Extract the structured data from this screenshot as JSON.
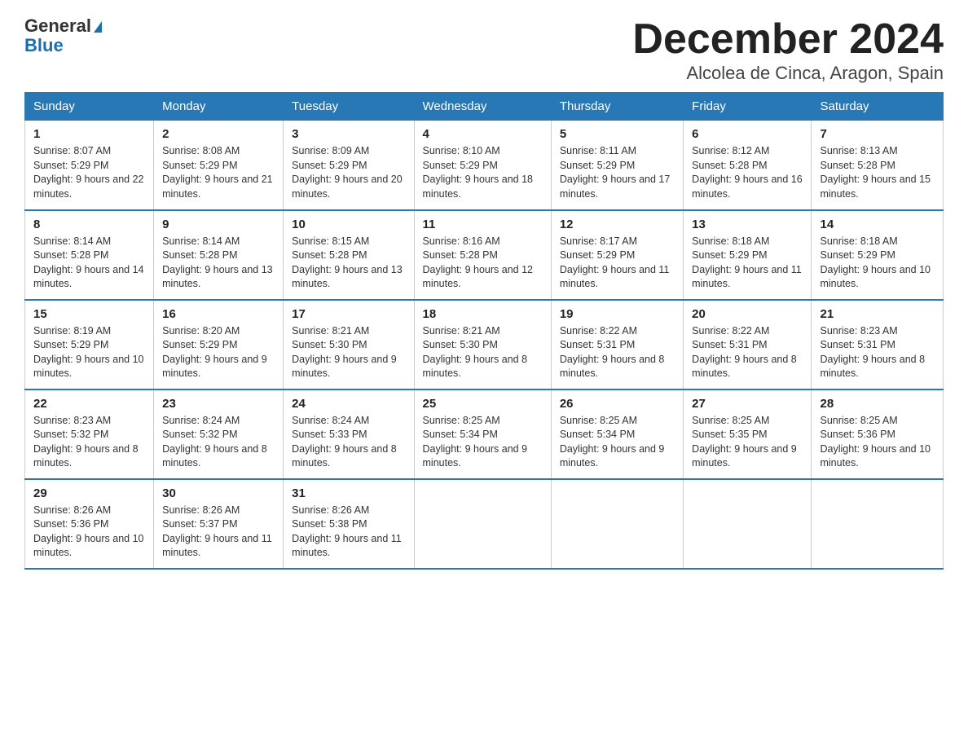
{
  "logo": {
    "line1": "General",
    "line2": "Blue"
  },
  "title": "December 2024",
  "subtitle": "Alcolea de Cinca, Aragon, Spain",
  "days_of_week": [
    "Sunday",
    "Monday",
    "Tuesday",
    "Wednesday",
    "Thursday",
    "Friday",
    "Saturday"
  ],
  "weeks": [
    [
      {
        "day": "1",
        "sunrise": "8:07 AM",
        "sunset": "5:29 PM",
        "daylight": "9 hours and 22 minutes."
      },
      {
        "day": "2",
        "sunrise": "8:08 AM",
        "sunset": "5:29 PM",
        "daylight": "9 hours and 21 minutes."
      },
      {
        "day": "3",
        "sunrise": "8:09 AM",
        "sunset": "5:29 PM",
        "daylight": "9 hours and 20 minutes."
      },
      {
        "day": "4",
        "sunrise": "8:10 AM",
        "sunset": "5:29 PM",
        "daylight": "9 hours and 18 minutes."
      },
      {
        "day": "5",
        "sunrise": "8:11 AM",
        "sunset": "5:29 PM",
        "daylight": "9 hours and 17 minutes."
      },
      {
        "day": "6",
        "sunrise": "8:12 AM",
        "sunset": "5:28 PM",
        "daylight": "9 hours and 16 minutes."
      },
      {
        "day": "7",
        "sunrise": "8:13 AM",
        "sunset": "5:28 PM",
        "daylight": "9 hours and 15 minutes."
      }
    ],
    [
      {
        "day": "8",
        "sunrise": "8:14 AM",
        "sunset": "5:28 PM",
        "daylight": "9 hours and 14 minutes."
      },
      {
        "day": "9",
        "sunrise": "8:14 AM",
        "sunset": "5:28 PM",
        "daylight": "9 hours and 13 minutes."
      },
      {
        "day": "10",
        "sunrise": "8:15 AM",
        "sunset": "5:28 PM",
        "daylight": "9 hours and 13 minutes."
      },
      {
        "day": "11",
        "sunrise": "8:16 AM",
        "sunset": "5:28 PM",
        "daylight": "9 hours and 12 minutes."
      },
      {
        "day": "12",
        "sunrise": "8:17 AM",
        "sunset": "5:29 PM",
        "daylight": "9 hours and 11 minutes."
      },
      {
        "day": "13",
        "sunrise": "8:18 AM",
        "sunset": "5:29 PM",
        "daylight": "9 hours and 11 minutes."
      },
      {
        "day": "14",
        "sunrise": "8:18 AM",
        "sunset": "5:29 PM",
        "daylight": "9 hours and 10 minutes."
      }
    ],
    [
      {
        "day": "15",
        "sunrise": "8:19 AM",
        "sunset": "5:29 PM",
        "daylight": "9 hours and 10 minutes."
      },
      {
        "day": "16",
        "sunrise": "8:20 AM",
        "sunset": "5:29 PM",
        "daylight": "9 hours and 9 minutes."
      },
      {
        "day": "17",
        "sunrise": "8:21 AM",
        "sunset": "5:30 PM",
        "daylight": "9 hours and 9 minutes."
      },
      {
        "day": "18",
        "sunrise": "8:21 AM",
        "sunset": "5:30 PM",
        "daylight": "9 hours and 8 minutes."
      },
      {
        "day": "19",
        "sunrise": "8:22 AM",
        "sunset": "5:31 PM",
        "daylight": "9 hours and 8 minutes."
      },
      {
        "day": "20",
        "sunrise": "8:22 AM",
        "sunset": "5:31 PM",
        "daylight": "9 hours and 8 minutes."
      },
      {
        "day": "21",
        "sunrise": "8:23 AM",
        "sunset": "5:31 PM",
        "daylight": "9 hours and 8 minutes."
      }
    ],
    [
      {
        "day": "22",
        "sunrise": "8:23 AM",
        "sunset": "5:32 PM",
        "daylight": "9 hours and 8 minutes."
      },
      {
        "day": "23",
        "sunrise": "8:24 AM",
        "sunset": "5:32 PM",
        "daylight": "9 hours and 8 minutes."
      },
      {
        "day": "24",
        "sunrise": "8:24 AM",
        "sunset": "5:33 PM",
        "daylight": "9 hours and 8 minutes."
      },
      {
        "day": "25",
        "sunrise": "8:25 AM",
        "sunset": "5:34 PM",
        "daylight": "9 hours and 9 minutes."
      },
      {
        "day": "26",
        "sunrise": "8:25 AM",
        "sunset": "5:34 PM",
        "daylight": "9 hours and 9 minutes."
      },
      {
        "day": "27",
        "sunrise": "8:25 AM",
        "sunset": "5:35 PM",
        "daylight": "9 hours and 9 minutes."
      },
      {
        "day": "28",
        "sunrise": "8:25 AM",
        "sunset": "5:36 PM",
        "daylight": "9 hours and 10 minutes."
      }
    ],
    [
      {
        "day": "29",
        "sunrise": "8:26 AM",
        "sunset": "5:36 PM",
        "daylight": "9 hours and 10 minutes."
      },
      {
        "day": "30",
        "sunrise": "8:26 AM",
        "sunset": "5:37 PM",
        "daylight": "9 hours and 11 minutes."
      },
      {
        "day": "31",
        "sunrise": "8:26 AM",
        "sunset": "5:38 PM",
        "daylight": "9 hours and 11 minutes."
      },
      null,
      null,
      null,
      null
    ]
  ]
}
